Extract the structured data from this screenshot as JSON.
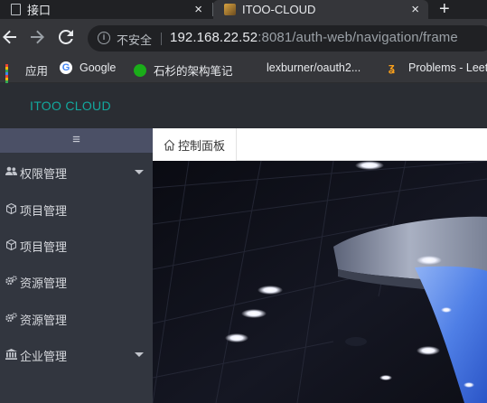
{
  "browser": {
    "tabs": [
      {
        "title": "接口",
        "active": false
      },
      {
        "title": "ITOO-CLOUD",
        "active": true
      }
    ],
    "close_glyph": "×",
    "new_tab_glyph": "+",
    "security_label": "不安全",
    "url_host": "192.168.22.52",
    "url_rest": ":8081/auth-web/navigation/frame",
    "bookmarks": [
      {
        "label": "应用",
        "icon": "apps-icon"
      },
      {
        "label": "Google",
        "icon": "google-icon"
      },
      {
        "label": "石杉的架构笔记",
        "icon": "wechat-icon"
      },
      {
        "label": "lexburner/oauth2...",
        "icon": "page-icon"
      },
      {
        "label": "Problems - Leet",
        "icon": "leetcode-icon"
      }
    ]
  },
  "app": {
    "brand": "ITOO CLOUD",
    "menu_toggle_glyph": "≡",
    "sidebar": [
      {
        "label": "权限管理",
        "icon": "users-icon",
        "expandable": true
      },
      {
        "label": "项目管理",
        "icon": "cube-icon",
        "expandable": false
      },
      {
        "label": "项目管理",
        "icon": "cube-icon",
        "expandable": false
      },
      {
        "label": "资源管理",
        "icon": "cogs-icon",
        "expandable": false
      },
      {
        "label": "资源管理",
        "icon": "cogs-icon",
        "expandable": false
      },
      {
        "label": "企业管理",
        "icon": "bank-icon",
        "expandable": true
      }
    ],
    "tabs": [
      {
        "label": "控制面板",
        "icon": "home-icon"
      }
    ]
  },
  "colors": {
    "brand": "#13a89e",
    "sidebar_bg": "#32363f",
    "sidebar_toggle_bg": "#4b5066",
    "header_bg": "#2a2d33"
  }
}
